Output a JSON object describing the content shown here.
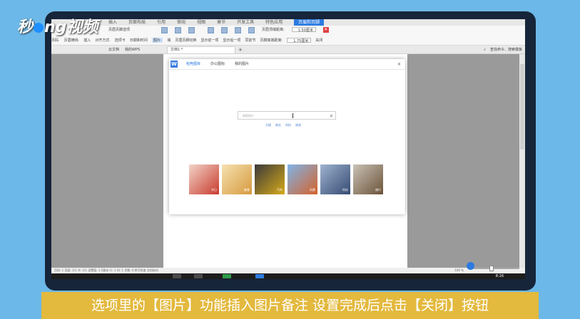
{
  "watermark": {
    "prefix": "秒",
    "suffix": "ng视频"
  },
  "menubar": {
    "items": [
      "插入",
      "页面布局",
      "引用",
      "审阅",
      "视图",
      "章节",
      "开发工具",
      "特色应用"
    ],
    "active": "页眉和页脚"
  },
  "ribbon": {
    "row1": [
      "页眉页脚选项"
    ],
    "row2": [
      "页码·",
      "页眉横线·",
      "插入",
      "对齐方式·",
      "选项卡",
      "日期和时间",
      "图片·",
      "域",
      "页眉页脚切换",
      "显示前一项",
      "显示后一项",
      "同前节"
    ],
    "header_distance_label": "页眉顶端距离:",
    "header_distance_value": "1.50厘米",
    "footer_distance_label": "页脚底端距离:",
    "footer_distance_value": "1.75厘米",
    "close_label": "关闭"
  },
  "tabbar": {
    "left": [
      "云文档",
      "我的WPS"
    ],
    "doc_tab": "文档1 *",
    "new_tab": "+",
    "search_label": "查找命令、搜索模板"
  },
  "dialog": {
    "logo": "W",
    "tabs": [
      "稻壳图库",
      "办公图标",
      "我的图片"
    ],
    "search_placeholder": "搜索图片",
    "tags": [
      "大楼",
      "商业",
      "科技",
      "旅游"
    ],
    "thumbnails": [
      {
        "label": "节日",
        "color": "#c93a2e"
      },
      {
        "label": "美食",
        "color": "#d79a3e"
      },
      {
        "label": "汽车",
        "color": "#d7a91a"
      },
      {
        "label": "风景",
        "color": "#d4622b"
      },
      {
        "label": "科技",
        "color": "#344a72"
      },
      {
        "label": "旅行",
        "color": "#6b5238"
      }
    ]
  },
  "statusbar": {
    "left": "页码: 1  页面: 1/1  节: 1/1  设置值: 1.5厘米  行: 1  列: 1  字数: 0  拼写检查  文档校对",
    "zoom": "100 %"
  },
  "taskbar": {
    "clock": "8:16"
  },
  "caption": "选项里的【图片】功能插入图片备注 设置完成后点击【关闭】按钮"
}
